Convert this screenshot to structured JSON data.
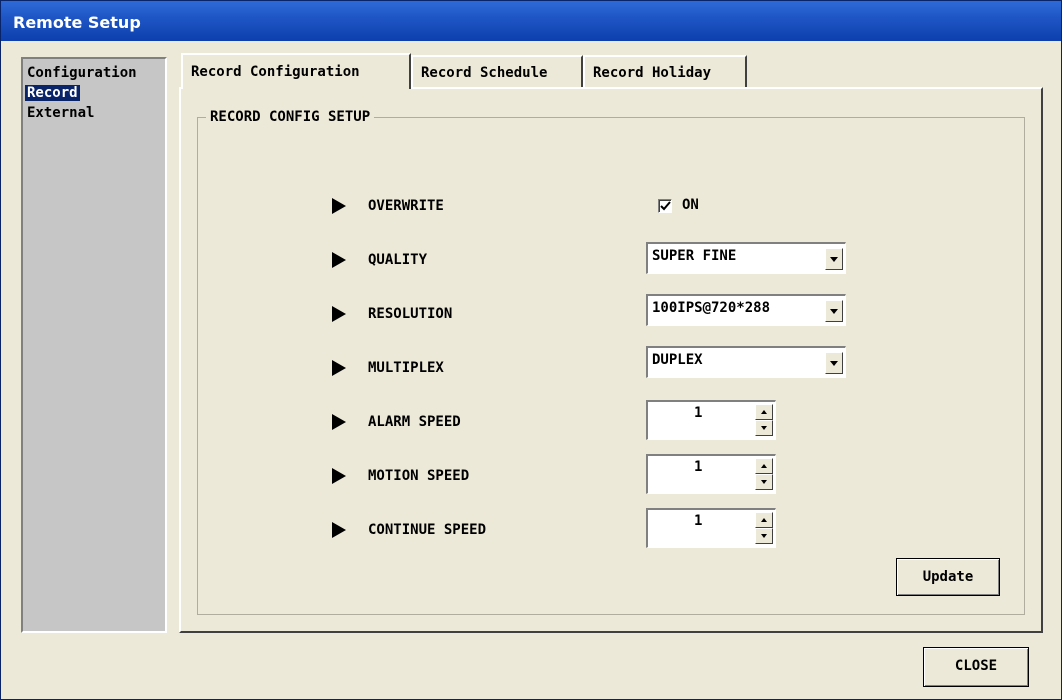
{
  "window": {
    "title": "Remote Setup"
  },
  "sidebar": {
    "items": [
      {
        "label": "Configuration",
        "selected": false
      },
      {
        "label": "Record",
        "selected": true
      },
      {
        "label": "External",
        "selected": false
      }
    ]
  },
  "tabs": [
    {
      "label": "Record Configuration",
      "active": true
    },
    {
      "label": "Record Schedule",
      "active": false
    },
    {
      "label": "Record Holiday",
      "active": false
    }
  ],
  "group": {
    "title": "RECORD CONFIG SETUP"
  },
  "settings": {
    "overwrite": {
      "label": "OVERWRITE",
      "checkbox_label": "ON",
      "checked": true
    },
    "quality": {
      "label": "QUALITY",
      "value": "SUPER FINE"
    },
    "resolution": {
      "label": "RESOLUTION",
      "value": "100IPS@720*288"
    },
    "multiplex": {
      "label": "MULTIPLEX",
      "value": "DUPLEX"
    },
    "alarm_speed": {
      "label": "ALARM SPEED",
      "value": "1"
    },
    "motion_speed": {
      "label": "MOTION SPEED",
      "value": "1"
    },
    "continue_speed": {
      "label": "CONTINUE SPEED",
      "value": "1"
    }
  },
  "buttons": {
    "update": "Update",
    "close": "CLOSE"
  },
  "colors": {
    "title_bar": "#1f56c6",
    "selection": "#0a246a",
    "face": "#ece9d8"
  }
}
